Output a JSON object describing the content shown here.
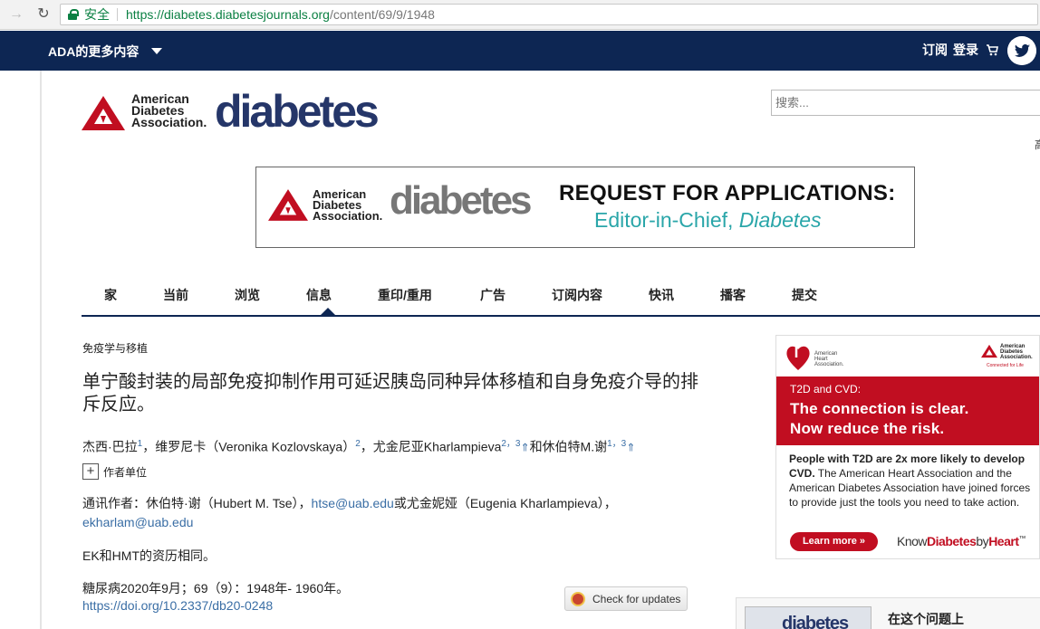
{
  "browser": {
    "secure_label": "安全",
    "url_base": "https://diabetes.diabetesjournals.org",
    "url_path": "/content/69/9/1948"
  },
  "topnav": {
    "ada_more": "ADA的更多内容",
    "subscribe": "订阅",
    "login": "登录"
  },
  "header": {
    "ada_line1": "American",
    "ada_line2": "Diabetes",
    "ada_line3": "Association.",
    "journal_name": "diabetes",
    "search_placeholder": "搜索...",
    "edge_char": "高"
  },
  "banner": {
    "ada_line1": "American",
    "ada_line2": "Diabetes",
    "ada_line3": "Association.",
    "journal_name": "diabetes",
    "headline": "REQUEST FOR APPLICATIONS:",
    "sub_prefix": "Editor-in-Chief, ",
    "sub_italic": "Diabetes"
  },
  "mainnav": {
    "items": [
      "家",
      "当前",
      "浏览",
      "信息",
      "重印/重用",
      "广告",
      "订阅内容",
      "快讯",
      "播客",
      "提交"
    ]
  },
  "article": {
    "section": "免疫学与移植",
    "title": "单宁酸封装的局部免疫抑制作用可延迟胰岛同种异体移植和自身免疫介导的排斥反应。",
    "author1": "杰西·巴拉",
    "author1_sup": "1",
    "sep1": "，维罗尼卡（Veronika Kozlovskaya）",
    "author2_sup": "2",
    "sep2": "，尤金尼亚Kharlampieva",
    "author3_sup": "2，3",
    "arrow": "⇑",
    "sep3": "和休伯特M.谢",
    "author4_sup": "1，3",
    "affil_toggle": "+",
    "affil_label": "作者单位",
    "corr_prefix": "通讯作者：休伯特·谢（Hubert M. Tse），",
    "corr_email1": "htse@uab.edu",
    "corr_mid": "或尤金妮娅（Eugenia Kharlampieva），",
    "corr_email2": "ekharlam@uab.edu",
    "contrib_note": "EK和HMT的资历相同。",
    "citation": "糖尿病2020年9月；69（9）：1948年- 1960年。",
    "doi": "https://doi.org/10.2337/db20-0248",
    "check_updates": "Check for updates"
  },
  "ad": {
    "aha_line1": "American",
    "aha_line2": "Heart",
    "aha_line3": "Association.",
    "ada_line1": "American",
    "ada_line2": "Diabetes",
    "ada_line3": "Association.",
    "ada_tag": "Connected for Life",
    "t2d": "T2D and CVD:",
    "head_line1": "The connection is clear.",
    "head_line2": "Now reduce the risk.",
    "body_bold": "People with T2D are 2x more likely to develop CVD.",
    "body_rest": " The American Heart Association and the American Diabetes Association have joined forces to provide just the tools you need to take action.",
    "learn_more": "Learn more »",
    "kdbh_a": "Know",
    "kdbh_b": "Diabetes",
    "kdbh_c": "by",
    "kdbh_d": "Heart",
    "kdbh_tm": "™"
  },
  "issue": {
    "cover_word": "diabetes",
    "label": "在这个问题上"
  },
  "colors": {
    "navy": "#0d2653",
    "ada_red": "#c10e21",
    "journal_blue": "#253669",
    "teal": "#2aa6a9",
    "link": "#3a6ea5"
  }
}
